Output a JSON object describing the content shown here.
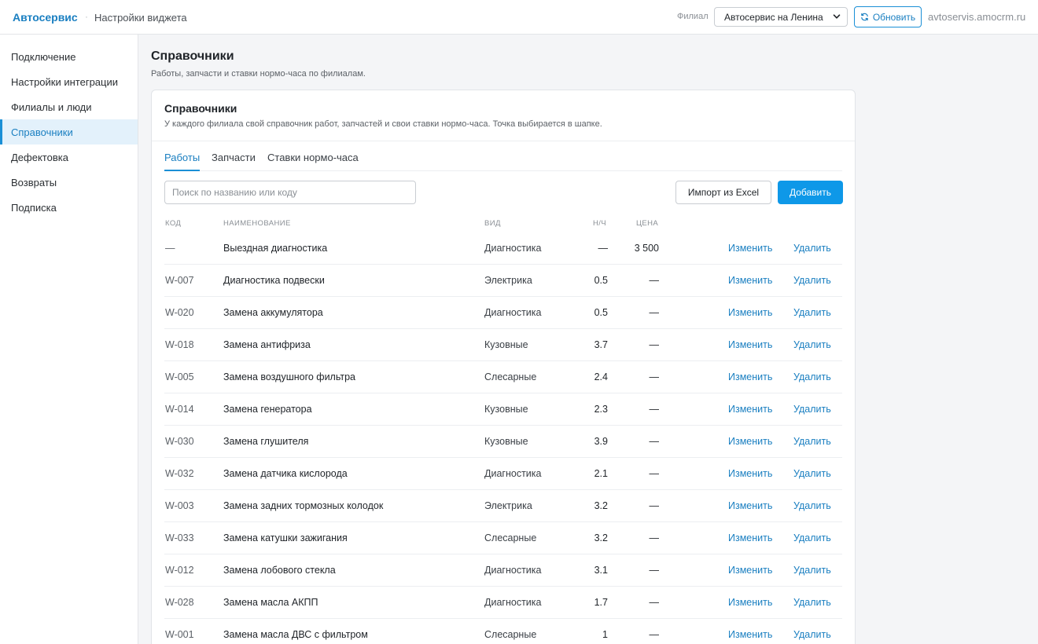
{
  "header": {
    "brand": "Автосервис",
    "separator": "·",
    "breadcrumb": "Настройки виджета",
    "branch_label": "Филиал",
    "branch_selected": "Автосервис на Ленина",
    "refresh_label": "Обновить",
    "domain": "avtoservis.amocrm.ru"
  },
  "sidebar": {
    "items": [
      {
        "label": "Подключение"
      },
      {
        "label": "Настройки интеграции"
      },
      {
        "label": "Филиалы и люди"
      },
      {
        "label": "Справочники"
      },
      {
        "label": "Дефектовка"
      },
      {
        "label": "Возвраты"
      },
      {
        "label": "Подписка"
      }
    ],
    "active_index": 3
  },
  "page": {
    "title": "Справочники",
    "subtitle": "Работы, запчасти и ставки нормо-часа по филиалам."
  },
  "card": {
    "title": "Справочники",
    "subtitle": "У каждого филиала свой справочник работ, запчастей и свои ставки нормо-часа. Точка выбирается в шапке.",
    "tabs": [
      {
        "label": "Работы",
        "active": true
      },
      {
        "label": "Запчасти",
        "active": false
      },
      {
        "label": "Ставки нормо-часа",
        "active": false
      }
    ],
    "search_placeholder": "Поиск по названию или коду",
    "import_label": "Импорт из Excel",
    "add_label": "Добавить",
    "columns": {
      "code": "КОД",
      "name": "НАИМЕНОВАНИЕ",
      "kind": "ВИД",
      "nh": "Н/Ч",
      "price": "ЦЕНА"
    },
    "edit_label": "Изменить",
    "delete_label": "Удалить",
    "rows": [
      {
        "code": "—",
        "name": "Выездная диагностика",
        "kind": "Диагностика",
        "nh": "—",
        "price": "3 500"
      },
      {
        "code": "W-007",
        "name": "Диагностика подвески",
        "kind": "Электрика",
        "nh": "0.5",
        "price": "—"
      },
      {
        "code": "W-020",
        "name": "Замена аккумулятора",
        "kind": "Диагностика",
        "nh": "0.5",
        "price": "—"
      },
      {
        "code": "W-018",
        "name": "Замена антифриза",
        "kind": "Кузовные",
        "nh": "3.7",
        "price": "—"
      },
      {
        "code": "W-005",
        "name": "Замена воздушного фильтра",
        "kind": "Слесарные",
        "nh": "2.4",
        "price": "—"
      },
      {
        "code": "W-014",
        "name": "Замена генератора",
        "kind": "Кузовные",
        "nh": "2.3",
        "price": "—"
      },
      {
        "code": "W-030",
        "name": "Замена глушителя",
        "kind": "Кузовные",
        "nh": "3.9",
        "price": "—"
      },
      {
        "code": "W-032",
        "name": "Замена датчика кислорода",
        "kind": "Диагностика",
        "nh": "2.1",
        "price": "—"
      },
      {
        "code": "W-003",
        "name": "Замена задних тормозных колодок",
        "kind": "Электрика",
        "nh": "3.2",
        "price": "—"
      },
      {
        "code": "W-033",
        "name": "Замена катушки зажигания",
        "kind": "Слесарные",
        "nh": "3.2",
        "price": "—"
      },
      {
        "code": "W-012",
        "name": "Замена лобового стекла",
        "kind": "Диагностика",
        "nh": "3.1",
        "price": "—"
      },
      {
        "code": "W-028",
        "name": "Замена масла АКПП",
        "kind": "Диагностика",
        "nh": "1.7",
        "price": "—"
      },
      {
        "code": "W-001",
        "name": "Замена масла ДВС с фильтром",
        "kind": "Слесарные",
        "nh": "1",
        "price": "—"
      }
    ]
  },
  "colors": {
    "accent": "#1a8fd6",
    "primary_button": "#0e98e8",
    "active_nav_bg": "#e3f1fb"
  },
  "icons": {
    "refresh": "refresh-icon",
    "dropdown": "chevron-down-icon"
  }
}
